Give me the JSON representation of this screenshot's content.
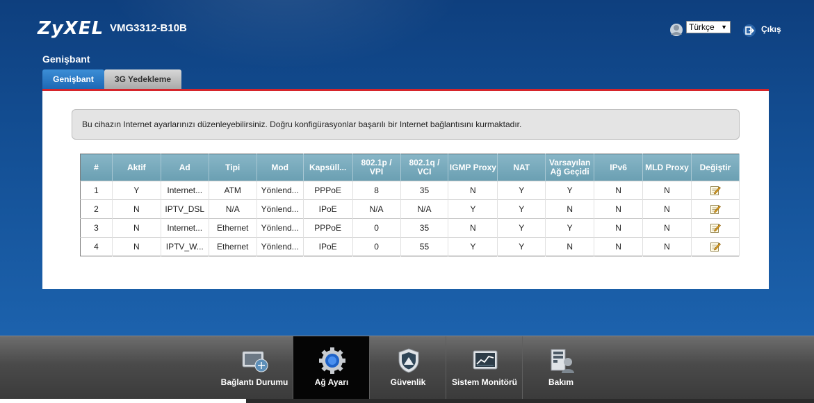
{
  "header": {
    "brand": "ZyXEL",
    "model": "VMG3312-B10B",
    "language": "Türkçe",
    "logout_label": "Çıkış"
  },
  "page": {
    "title": "Genişbant",
    "tabs": [
      {
        "label": "Genişbant",
        "active": true
      },
      {
        "label": "3G Yedekleme",
        "active": false
      }
    ],
    "info_text": "Bu cihazın Internet ayarlarınızı düzenleyebilirsiniz. Doğru konfigürasyonlar başarılı bir Internet bağlantısını kurmaktadır."
  },
  "table": {
    "headers": [
      "#",
      "Aktif",
      "Ad",
      "Tipi",
      "Mod",
      "Kapsüll...",
      "802.1p / VPI",
      "802.1q / VCI",
      "IGMP Proxy",
      "NAT",
      "Varsayılan Ağ Geçidi",
      "IPv6",
      "MLD Proxy",
      "Değiştir"
    ],
    "rows": [
      [
        "1",
        "Y",
        "Internet...",
        "ATM",
        "Yönlend...",
        "PPPoE",
        "8",
        "35",
        "N",
        "Y",
        "Y",
        "N",
        "N"
      ],
      [
        "2",
        "N",
        "IPTV_DSL",
        "N/A",
        "Yönlend...",
        "IPoE",
        "N/A",
        "N/A",
        "Y",
        "Y",
        "N",
        "N",
        "N"
      ],
      [
        "3",
        "N",
        "Internet...",
        "Ethernet",
        "Yönlend...",
        "PPPoE",
        "0",
        "35",
        "N",
        "Y",
        "Y",
        "N",
        "N"
      ],
      [
        "4",
        "N",
        "IPTV_W...",
        "Ethernet",
        "Yönlend...",
        "IPoE",
        "0",
        "55",
        "Y",
        "Y",
        "N",
        "N",
        "N"
      ]
    ],
    "edit_icon": "edit-icon"
  },
  "nav": {
    "items": [
      {
        "label": "Bağlantı Durumu",
        "icon": "connection-status-icon",
        "active": false
      },
      {
        "label": "Ağ Ayarı",
        "icon": "gear-icon",
        "active": true
      },
      {
        "label": "Güvenlik",
        "icon": "shield-icon",
        "active": false
      },
      {
        "label": "Sistem Monitörü",
        "icon": "monitor-icon",
        "active": false
      },
      {
        "label": "Bakım",
        "icon": "maintenance-icon",
        "active": false
      }
    ]
  },
  "colors": {
    "background_blue": "#1a5aa0",
    "accent_red": "#d6252b",
    "table_header": "#7aabbd",
    "nav_active": "#050505"
  }
}
